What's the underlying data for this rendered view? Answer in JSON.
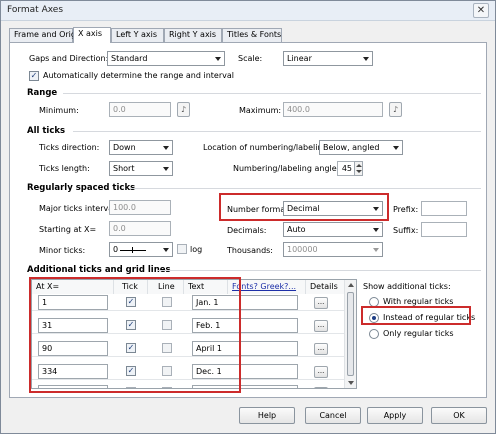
{
  "window": {
    "title": "Format Axes",
    "close_glyph": "✕"
  },
  "tabs": [
    {
      "label": "Frame and Origin"
    },
    {
      "label": "X axis",
      "active": true
    },
    {
      "label": "Left Y axis"
    },
    {
      "label": "Right Y axis"
    },
    {
      "label": "Titles & Fonts"
    }
  ],
  "top": {
    "gaps_label": "Gaps and Direction:",
    "gaps_value": "Standard",
    "scale_label": "Scale:",
    "scale_value": "Linear",
    "auto_label": "Automatically determine the range and interval",
    "auto_checked": true
  },
  "range": {
    "header": "Range",
    "minimum_label": "Minimum:",
    "minimum_value": "0.0",
    "maximum_label": "Maximum:",
    "maximum_value": "400.0"
  },
  "all_ticks": {
    "header": "All ticks",
    "direction_label": "Ticks direction:",
    "direction_value": "Down",
    "location_label": "Location of numbering/labeling:",
    "location_value": "Below, angled",
    "length_label": "Ticks length:",
    "length_value": "Short",
    "angle_label": "Numbering/labeling angle:",
    "angle_value": "45"
  },
  "regular": {
    "header": "Regularly spaced ticks",
    "major_label": "Major ticks interval:",
    "major_value": "100.0",
    "start_label": "Starting at X=",
    "start_value": "0.0",
    "minor_label": "Minor ticks:",
    "minor_value": "0",
    "log_label": "log",
    "number_format_label": "Number format:",
    "number_format_value": "Decimal",
    "decimals_label": "Decimals:",
    "decimals_value": "Auto",
    "thousands_label": "Thousands:",
    "thousands_value": "100000",
    "prefix_label": "Prefix:",
    "suffix_label": "Suffix:"
  },
  "additional": {
    "header": "Additional ticks and grid lines",
    "columns": {
      "at_x": "At X=",
      "tick": "Tick",
      "line": "Line",
      "text": "Text",
      "fonts": "Fonts? Greek?...",
      "details": "Details"
    },
    "rows": [
      {
        "x": "1",
        "tick": true,
        "line": false,
        "text": "Jan. 1",
        "details": "..."
      },
      {
        "x": "31",
        "tick": true,
        "line": false,
        "text": "Feb. 1",
        "details": "..."
      },
      {
        "x": "90",
        "tick": true,
        "line": false,
        "text": "April 1",
        "details": "..."
      },
      {
        "x": "334",
        "tick": true,
        "line": false,
        "text": "Dec. 1",
        "details": "..."
      },
      {
        "x": "",
        "tick": false,
        "line": false,
        "text": "",
        "details": "..."
      }
    ],
    "show_label": "Show additional ticks:",
    "options": [
      {
        "label": "With regular ticks",
        "selected": false
      },
      {
        "label": "Instead of regular ticks",
        "selected": true
      },
      {
        "label": "Only regular ticks",
        "selected": false
      }
    ]
  },
  "buttons": {
    "help": "Help",
    "cancel": "Cancel",
    "apply": "Apply",
    "ok": "OK"
  },
  "colors": {
    "highlight": "#cc2b2b",
    "link": "#1d2fa8"
  }
}
